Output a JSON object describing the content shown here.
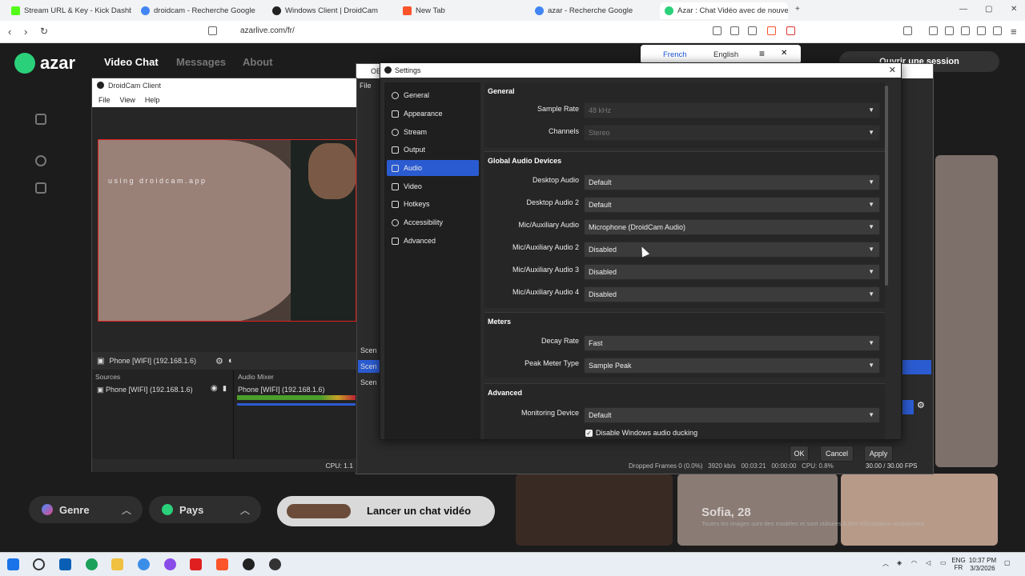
{
  "browser": {
    "tabs": [
      {
        "title": "Stream URL & Key - Kick Dashboard",
        "color": "#53fc18"
      },
      {
        "title": "droidcam - Recherche Google",
        "color": "#4285f4"
      },
      {
        "title": "Windows Client | DroidCam",
        "color": "#222222"
      },
      {
        "title": "New Tab",
        "color": "#fb542b"
      },
      {
        "title": "azar - Recherche Google",
        "color": "#4285f4"
      },
      {
        "title": "Azar : Chat Vidéo avec de nouve",
        "color": "#2ad07a"
      }
    ],
    "url": "azarlive.com/fr/",
    "new_tab": "+",
    "translate": {
      "french": "French",
      "english": "English"
    }
  },
  "azar": {
    "logo": "azar",
    "nav": [
      "Video Chat",
      "Messages",
      "About"
    ],
    "login_button": "Ouvrir une session",
    "genre_label": "Genre",
    "pays_label": "Pays",
    "launch_label": "Lancer un chat vidéo",
    "card_name": "Sofia, 28",
    "disclaimer": "Toutes les images sont des modèles et sont utilisées à titre d'illustration uniquement"
  },
  "droidcam": {
    "title": "DroidCam Client",
    "menu": [
      "File",
      "View",
      "Help"
    ],
    "watermark": "using droidcam.app",
    "source_name": "Phone [WIFI] (192.168.1.6)",
    "sources_header": "Sources",
    "mixer_header": "Audio Mixer",
    "cpu": "CPU: 1.1"
  },
  "obs": {
    "title": "OB",
    "file": "File",
    "scene_header": "Scen",
    "scene_items": [
      "Scen",
      "Scen"
    ],
    "dropped_frames": "Dropped Frames 0 (0.0%)",
    "kbps": "3920 kb/s",
    "time": "00:03:21",
    "rec_time": "00:00:00",
    "cpu": "CPU: 0.8%",
    "fps": "30.00 / 30.00 FPS"
  },
  "settings": {
    "title": "Settings",
    "categories": [
      "General",
      "Appearance",
      "Stream",
      "Output",
      "Audio",
      "Video",
      "Hotkeys",
      "Accessibility",
      "Advanced"
    ],
    "selected": "Audio",
    "general": {
      "header": "General",
      "sample_rate_label": "Sample Rate",
      "sample_rate_value": "48 kHz",
      "channels_label": "Channels",
      "channels_value": "Stereo"
    },
    "devices": {
      "header": "Global Audio Devices",
      "rows": [
        {
          "label": "Desktop Audio",
          "value": "Default"
        },
        {
          "label": "Desktop Audio 2",
          "value": "Default"
        },
        {
          "label": "Mic/Auxiliary Audio",
          "value": "Microphone (DroidCam Audio)"
        },
        {
          "label": "Mic/Auxiliary Audio 2",
          "value": "Disabled"
        },
        {
          "label": "Mic/Auxiliary Audio 3",
          "value": "Disabled"
        },
        {
          "label": "Mic/Auxiliary Audio 4",
          "value": "Disabled"
        }
      ]
    },
    "meters": {
      "header": "Meters",
      "decay_label": "Decay Rate",
      "decay_value": "Fast",
      "peak_label": "Peak Meter Type",
      "peak_value": "Sample Peak"
    },
    "advanced": {
      "header": "Advanced",
      "monitor_label": "Monitoring Device",
      "monitor_value": "Default",
      "ducking_label": "Disable Windows audio ducking",
      "ducking_checked": true
    },
    "buttons": {
      "ok": "OK",
      "cancel": "Cancel",
      "apply": "Apply"
    }
  },
  "taskbar": {
    "lang": "ENG",
    "region": "FR",
    "time": "10:37 PM",
    "date": "3/3/2026"
  }
}
